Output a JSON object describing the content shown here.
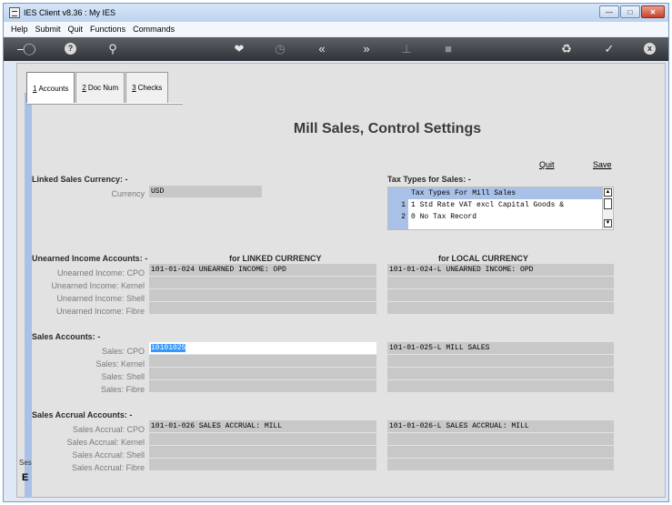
{
  "window": {
    "title": "IES Client v8.36 : My IES"
  },
  "menu": [
    "Help",
    "Submit",
    "Quit",
    "Functions",
    "Commands"
  ],
  "toolbar": {
    "icons": [
      "key-icon",
      "help-icon",
      "search-icon",
      "heart-icon",
      "clock-icon",
      "rewind-icon",
      "fast-forward-icon",
      "text-cursor-icon",
      "stop-icon",
      "recycle-icon",
      "check-icon",
      "close-icon"
    ],
    "help_glyph": "?",
    "close_glyph": "x"
  },
  "tabs": [
    {
      "key": "1",
      "label": "Accounts",
      "active": true
    },
    {
      "key": "2",
      "label": "Doc Num",
      "active": false
    },
    {
      "key": "3",
      "label": "Checks",
      "active": false
    }
  ],
  "page": {
    "title": "Mill Sales, Control Settings"
  },
  "actions": {
    "quit": "Quit",
    "save": "Save"
  },
  "linked_currency": {
    "heading": "Linked Sales Currency: -",
    "label": "Currency",
    "value": "USD"
  },
  "tax_types": {
    "heading": "Tax Types for Sales: -",
    "header": "Tax Types For Mill Sales",
    "rows": [
      {
        "num": "1",
        "text": "1 Std Rate VAT excl Capital Goods &"
      },
      {
        "num": "2",
        "text": "0 No Tax Record"
      }
    ]
  },
  "columns": {
    "linked": "for LINKED CURRENCY",
    "local": "for LOCAL CURRENCY"
  },
  "unearned": {
    "heading": "Unearned Income Accounts: -",
    "rows": [
      {
        "label": "Unearned Income: CPO",
        "linked": "101-01-024 UNEARNED INCOME: OPD",
        "local": "101-01-024-L UNEARNED INCOME: OPD"
      },
      {
        "label": "Unearned Income: Kernel",
        "linked": "",
        "local": ""
      },
      {
        "label": "Unearned Income: Shell",
        "linked": "",
        "local": ""
      },
      {
        "label": "Unearned Income: Fibre",
        "linked": "",
        "local": ""
      }
    ]
  },
  "sales": {
    "heading": "Sales Accounts: -",
    "rows": [
      {
        "label": "Sales: CPO",
        "linked": "10101025",
        "local": "101-01-025-L MILL SALES"
      },
      {
        "label": "Sales: Kernel",
        "linked": "",
        "local": ""
      },
      {
        "label": "Sales: Shell",
        "linked": "",
        "local": ""
      },
      {
        "label": "Sales: Fibre",
        "linked": "",
        "local": ""
      }
    ]
  },
  "accrual": {
    "heading": "Sales Accrual Accounts: -",
    "rows": [
      {
        "label": "Sales Accrual: CPO",
        "linked": "101-01-026 SALES ACCRUAL: MILL",
        "local": "101-01-026-L SALES ACCRUAL: MILL"
      },
      {
        "label": "Sales Accrual: Kernel",
        "linked": "",
        "local": ""
      },
      {
        "label": "Sales Accrual: Shell",
        "linked": "",
        "local": ""
      },
      {
        "label": "Sales Accrual: Fibre",
        "linked": "",
        "local": ""
      }
    ]
  },
  "side_strip": {
    "label": "Ses",
    "glyph": "E"
  }
}
